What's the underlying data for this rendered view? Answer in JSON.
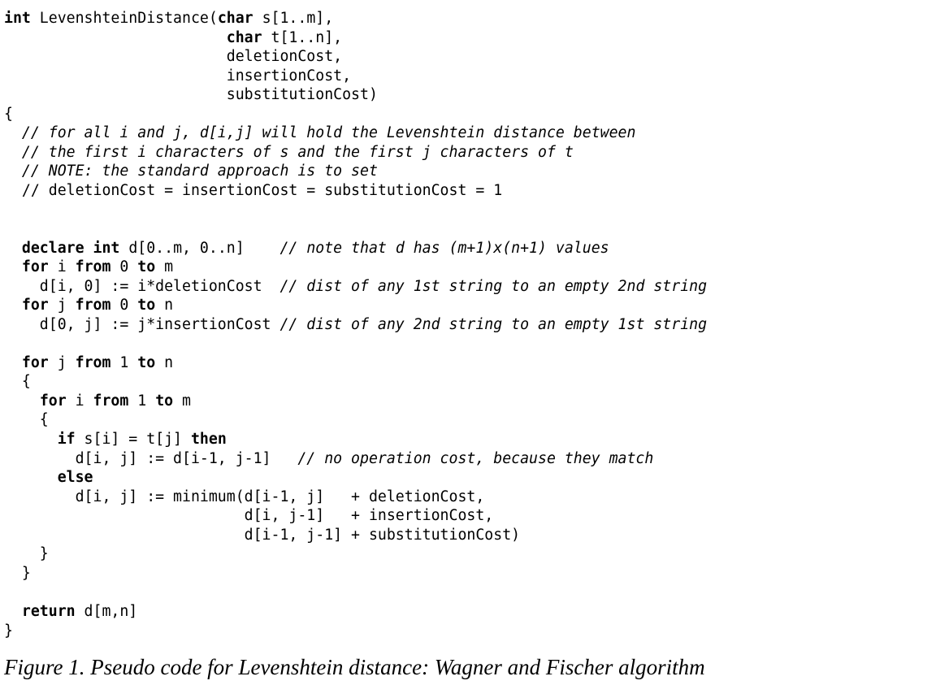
{
  "code_lines": [
    [
      {
        "t": "int",
        "s": "kw"
      },
      {
        "t": " LevenshteinDistance("
      },
      {
        "t": "char",
        "s": "kw"
      },
      {
        "t": " s[1..m],"
      }
    ],
    [
      {
        "t": "                         "
      },
      {
        "t": "char",
        "s": "kw"
      },
      {
        "t": " t[1..n],"
      }
    ],
    [
      {
        "t": "                         deletionCost,"
      }
    ],
    [
      {
        "t": "                         insertionCost,"
      }
    ],
    [
      {
        "t": "                         substitutionCost)"
      }
    ],
    [
      {
        "t": "{"
      }
    ],
    [
      {
        "t": "  "
      },
      {
        "t": "// for all i and j, d[i,j] will hold the Levenshtein distance between",
        "s": "cm"
      }
    ],
    [
      {
        "t": "  "
      },
      {
        "t": "// the first i characters of s and the first j characters of t",
        "s": "cm"
      }
    ],
    [
      {
        "t": "  "
      },
      {
        "t": "// NOTE: the standard approach is to set",
        "s": "cm"
      }
    ],
    [
      {
        "t": "  // deletionCost = insertionCost = substitutionCost = 1"
      }
    ],
    [],
    [],
    [
      {
        "t": "  "
      },
      {
        "t": "declare",
        "s": "kw"
      },
      {
        "t": " "
      },
      {
        "t": "int",
        "s": "kw"
      },
      {
        "t": " d[0..m, 0..n]    "
      },
      {
        "t": "// note that d has (m+1)x(n+1) values",
        "s": "cm"
      }
    ],
    [
      {
        "t": "  "
      },
      {
        "t": "for",
        "s": "kw"
      },
      {
        "t": " i "
      },
      {
        "t": "from",
        "s": "kw"
      },
      {
        "t": " 0 "
      },
      {
        "t": "to",
        "s": "kw"
      },
      {
        "t": " m"
      }
    ],
    [
      {
        "t": "    d[i, 0] := i*deletionCost  "
      },
      {
        "t": "// dist of any 1st string to an empty 2nd string",
        "s": "cm"
      }
    ],
    [
      {
        "t": "  "
      },
      {
        "t": "for",
        "s": "kw"
      },
      {
        "t": " j "
      },
      {
        "t": "from",
        "s": "kw"
      },
      {
        "t": " 0 "
      },
      {
        "t": "to",
        "s": "kw"
      },
      {
        "t": " n"
      }
    ],
    [
      {
        "t": "    d[0, j] := j*insertionCost "
      },
      {
        "t": "// dist of any 2nd string to an empty 1st string",
        "s": "cm"
      }
    ],
    [],
    [
      {
        "t": "  "
      },
      {
        "t": "for",
        "s": "kw"
      },
      {
        "t": " j "
      },
      {
        "t": "from",
        "s": "kw"
      },
      {
        "t": " 1 "
      },
      {
        "t": "to",
        "s": "kw"
      },
      {
        "t": " n"
      }
    ],
    [
      {
        "t": "  {"
      }
    ],
    [
      {
        "t": "    "
      },
      {
        "t": "for",
        "s": "kw"
      },
      {
        "t": " i "
      },
      {
        "t": "from",
        "s": "kw"
      },
      {
        "t": " 1 "
      },
      {
        "t": "to",
        "s": "kw"
      },
      {
        "t": " m"
      }
    ],
    [
      {
        "t": "    {"
      }
    ],
    [
      {
        "t": "      "
      },
      {
        "t": "if",
        "s": "kw"
      },
      {
        "t": " s[i] = t[j] "
      },
      {
        "t": "then",
        "s": "kw"
      }
    ],
    [
      {
        "t": "        d[i, j] := d[i-1, j-1]   "
      },
      {
        "t": "// no operation cost, because they match",
        "s": "cm"
      }
    ],
    [
      {
        "t": "      "
      },
      {
        "t": "else",
        "s": "kw"
      }
    ],
    [
      {
        "t": "        d[i, j] := minimum(d[i-1, j]   + deletionCost,"
      }
    ],
    [
      {
        "t": "                           d[i, j-1]   + insertionCost,"
      }
    ],
    [
      {
        "t": "                           d[i-1, j-1] + substitutionCost)"
      }
    ],
    [
      {
        "t": "    }"
      }
    ],
    [
      {
        "t": "  }"
      }
    ],
    [],
    [
      {
        "t": "  "
      },
      {
        "t": "return",
        "s": "kw"
      },
      {
        "t": " d[m,n]"
      }
    ],
    [
      {
        "t": "}"
      }
    ]
  ],
  "caption": "Figure 1. Pseudo code for Levenshtein distance: Wagner and Fischer algorithm"
}
